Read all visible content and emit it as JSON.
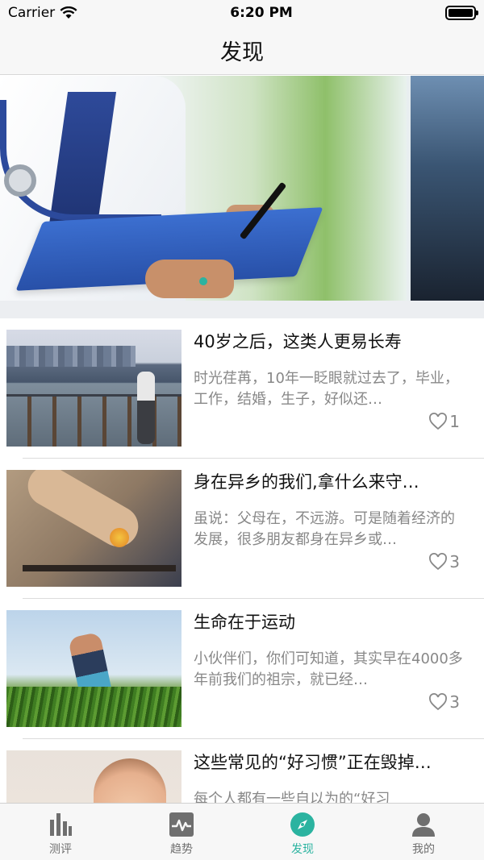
{
  "status_bar": {
    "carrier": "Carrier",
    "time": "6:20 PM"
  },
  "nav": {
    "title": "发现"
  },
  "banner": {
    "slides": 2,
    "active_index": 0
  },
  "articles": [
    {
      "title": "40岁之后，这类人更易长寿",
      "summary": "时光荏苒，10年一眨眼就过去了，毕业，工作，结婚，生子，好似还…",
      "likes": "1"
    },
    {
      "title": "身在异乡的我们,拿什么来守…",
      "summary": "虽说：父母在，不远游。可是随着经济的发展，很多朋友都身在异乡或…",
      "likes": "3"
    },
    {
      "title": "生命在于运动",
      "summary": "小伙伴们，你们可知道，其实早在4000多年前我们的祖宗，就已经…",
      "likes": "3"
    },
    {
      "title": "这些常见的“好习惯”正在毁掉…",
      "summary": "每个人都有一些自以为的“好习",
      "likes": ""
    }
  ],
  "tabs": [
    {
      "label": "测评",
      "icon": "bar-chart-icon",
      "active": false
    },
    {
      "label": "趋势",
      "icon": "trend-icon",
      "active": false
    },
    {
      "label": "发现",
      "icon": "compass-icon",
      "active": true
    },
    {
      "label": "我的",
      "icon": "user-icon",
      "active": false
    }
  ],
  "colors": {
    "accent": "#2bb3a0",
    "text_muted": "#888888",
    "bar_bg": "#f7f7f7"
  }
}
